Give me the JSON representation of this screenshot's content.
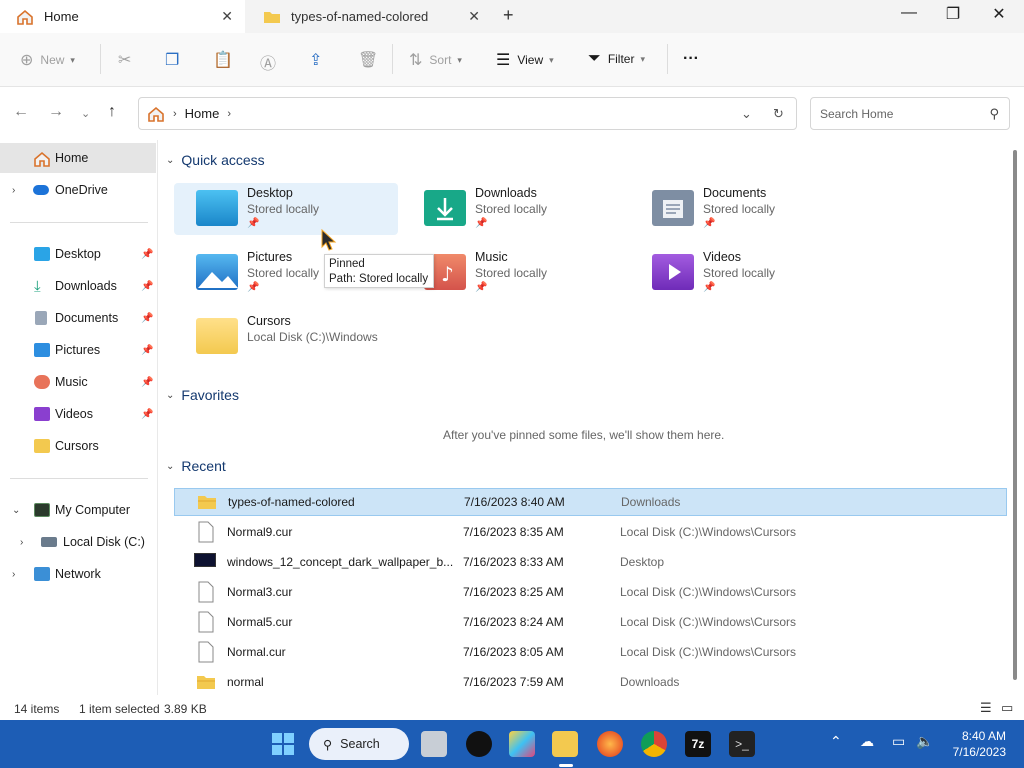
{
  "tabs": [
    {
      "label": "Home",
      "active": true,
      "icon": "home-icon"
    },
    {
      "label": "types-of-named-colored",
      "active": false,
      "icon": "folder-icon"
    }
  ],
  "window_controls": {
    "minimize": "—",
    "maximize": "❐",
    "close": "✕"
  },
  "toolbar": {
    "new_label": "New",
    "sort_label": "Sort",
    "view_label": "View",
    "filter_label": "Filter",
    "more_label": "···"
  },
  "address": {
    "crumb_home": "Home",
    "search_placeholder": "Search Home"
  },
  "sidebar": {
    "items": [
      {
        "label": "Home"
      },
      {
        "label": "OneDrive"
      },
      {
        "label": "Desktop"
      },
      {
        "label": "Downloads"
      },
      {
        "label": "Documents"
      },
      {
        "label": "Pictures"
      },
      {
        "label": "Music"
      },
      {
        "label": "Videos"
      },
      {
        "label": "Cursors"
      },
      {
        "label": "My Computer"
      },
      {
        "label": "Local Disk (C:)"
      },
      {
        "label": "Network"
      }
    ]
  },
  "quick_access": {
    "title": "Quick access",
    "tiles": [
      {
        "name": "Desktop",
        "sub": "Stored locally"
      },
      {
        "name": "Downloads",
        "sub": "Stored locally"
      },
      {
        "name": "Documents",
        "sub": "Stored locally"
      },
      {
        "name": "Pictures",
        "sub": "Stored locally"
      },
      {
        "name": "Music",
        "sub": "Stored locally"
      },
      {
        "name": "Videos",
        "sub": "Stored locally"
      },
      {
        "name": "Cursors",
        "sub": "Local Disk (C:)\\Windows"
      }
    ]
  },
  "tooltip": {
    "line1": "Pinned",
    "line2": "Path: Stored locally"
  },
  "favorites": {
    "title": "Favorites",
    "empty": "After you've pinned some files, we'll show them here."
  },
  "recent": {
    "title": "Recent",
    "rows": [
      {
        "name": "types-of-named-colored",
        "date": "7/16/2023 8:40 AM",
        "location": "Downloads"
      },
      {
        "name": "Normal9.cur",
        "date": "7/16/2023 8:35 AM",
        "location": "Local Disk (C:)\\Windows\\Cursors"
      },
      {
        "name": "windows_12_concept_dark_wallpaper_b...",
        "date": "7/16/2023 8:33 AM",
        "location": "Desktop"
      },
      {
        "name": "Normal3.cur",
        "date": "7/16/2023 8:25 AM",
        "location": "Local Disk (C:)\\Windows\\Cursors"
      },
      {
        "name": "Normal5.cur",
        "date": "7/16/2023 8:24 AM",
        "location": "Local Disk (C:)\\Windows\\Cursors"
      },
      {
        "name": "Normal.cur",
        "date": "7/16/2023 8:05 AM",
        "location": "Local Disk (C:)\\Windows\\Cursors"
      },
      {
        "name": "normal",
        "date": "7/16/2023 7:59 AM",
        "location": "Downloads"
      }
    ]
  },
  "status": {
    "count": "14 items",
    "selection": "1 item selected",
    "size": "3.89 KB"
  },
  "taskbar": {
    "search_label": "Search",
    "time": "8:40 AM",
    "date": "7/16/2023"
  },
  "colors": {
    "accent": "#1d5db5",
    "selection": "#cce4f7",
    "folder": "#f3c94f"
  }
}
